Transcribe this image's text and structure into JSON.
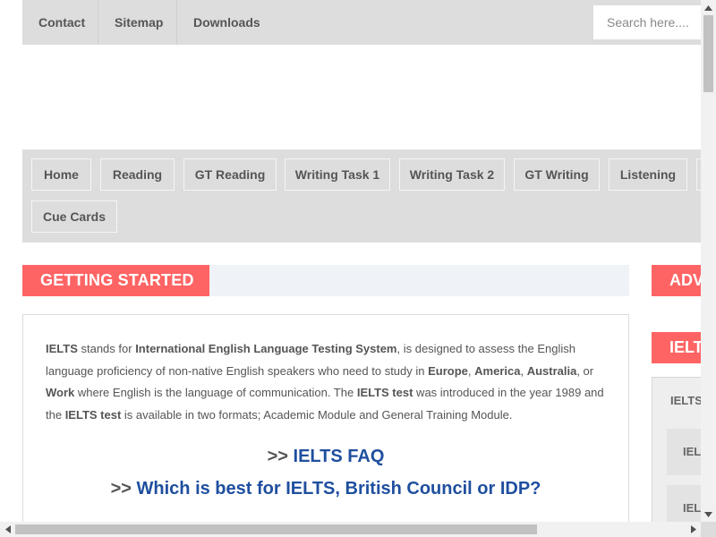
{
  "topbar": {
    "links": [
      "Contact",
      "Sitemap",
      "Downloads"
    ],
    "search_placeholder": "Search here...."
  },
  "nav": {
    "row1": [
      "Home",
      "Reading",
      "GT Reading",
      "Writing Task 1",
      "Writing Task 2",
      "GT Writing",
      "Listening"
    ],
    "row2": [
      "Cue Cards"
    ]
  },
  "section": {
    "title": "GETTING STARTED"
  },
  "intro": {
    "parts": [
      {
        "t": "IELTS",
        "b": true
      },
      {
        "t": " stands for ",
        "b": false
      },
      {
        "t": "International English Language Testing System",
        "b": true
      },
      {
        "t": ", is designed to assess the English language proficiency of non-native English speakers who need to study in ",
        "b": false
      },
      {
        "t": "Europe",
        "b": true
      },
      {
        "t": ", ",
        "b": false
      },
      {
        "t": "America",
        "b": true
      },
      {
        "t": ", ",
        "b": false
      },
      {
        "t": "Australia",
        "b": true
      },
      {
        "t": ", or ",
        "b": false
      },
      {
        "t": "Work",
        "b": true
      },
      {
        "t": " where English is the language of communication. The ",
        "b": false
      },
      {
        "t": "IELTS test",
        "b": true
      },
      {
        "t": " was introduced in the year 1989 and the ",
        "b": false
      },
      {
        "t": "IELTS test",
        "b": true
      },
      {
        "t": " is available in two formats; Academic Module and General Training Module.",
        "b": false
      }
    ]
  },
  "links": {
    "arrow": ">>",
    "faq": "IELTS FAQ",
    "which": "Which is best for IELTS, British Council or IDP?"
  },
  "sidebar": {
    "adv_title": "ADV",
    "ielts_title": "IELT",
    "box_label": "IELTS",
    "items": [
      "IEL",
      "IEL"
    ]
  },
  "colors": {
    "accent": "#ff6464",
    "link": "#1f4f9f",
    "bar_bg": "#dddddd"
  }
}
